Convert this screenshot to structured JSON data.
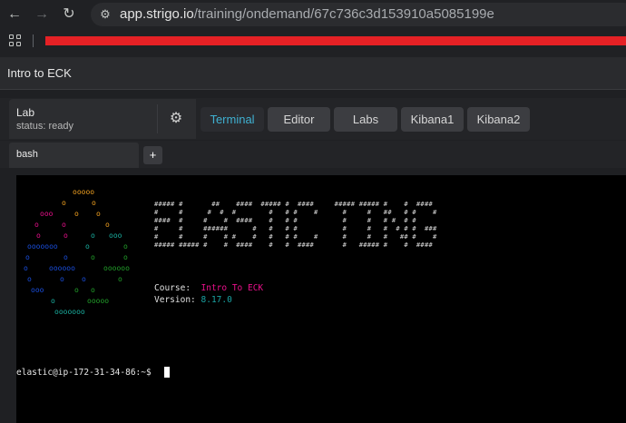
{
  "browser": {
    "url_host": "app.strigo.io",
    "url_path": "/training/ondemand/67c736c3d153910a5085199e"
  },
  "page": {
    "title": "Intro to ECK"
  },
  "lab": {
    "title": "Lab",
    "status": "status: ready"
  },
  "tabs": [
    {
      "label": "Terminal",
      "active": true
    },
    {
      "label": "Editor",
      "active": false
    },
    {
      "label": "Labs",
      "active": false
    },
    {
      "label": "Kibana1",
      "active": false
    },
    {
      "label": "Kibana2",
      "active": false
    }
  ],
  "terminal": {
    "tab_label": "bash",
    "add_tab_label": "+",
    "banner_lines": [
      "##### #       ##    ####  ##### #  ####     ##### ##### #    #  ####",
      "#     #      #  #  #        #   # #    #      #     #   ##   # #    #",
      "####  #     #    #  ####    #   # #           #     #   # #  # #",
      "#     #     ######      #   #   # #           #     #   #  # # #  ###",
      "#     #     #    # #    #   #   # #    #      #     #   #   ## #    #",
      "##### ##### #    #  ####    #   #  ####       #   ##### #    #  ####"
    ],
    "course_key": "Course:",
    "course_value": "Intro To ECK",
    "version_key": "Version:",
    "version_value": "8.17.0",
    "prompt": "elastic@ip-172-31-34-86:~$",
    "colors": {
      "course_value": "#e8108a",
      "version_value": "#1aa3a3",
      "logo": [
        "#f0a020",
        "#e8108a",
        "#1ab0a0",
        "#1a4fe0",
        "#22a02a"
      ]
    }
  }
}
